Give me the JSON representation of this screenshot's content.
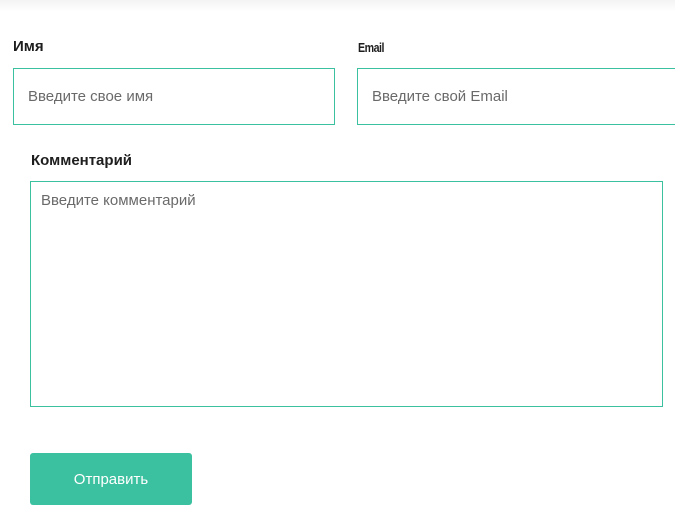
{
  "form": {
    "name": {
      "label": "Имя",
      "placeholder": "Введите свое имя",
      "value": ""
    },
    "email": {
      "label": "Email",
      "placeholder": "Введите свой Email",
      "value": ""
    },
    "comment": {
      "label": "Комментарий",
      "placeholder": "Введите комментарий",
      "value": ""
    },
    "submit_label": "Отправить"
  },
  "colors": {
    "accent": "#3cc1a0",
    "label_text": "#1e1e1e",
    "placeholder_text": "#6a6a6a",
    "button_text": "#ffffff"
  }
}
